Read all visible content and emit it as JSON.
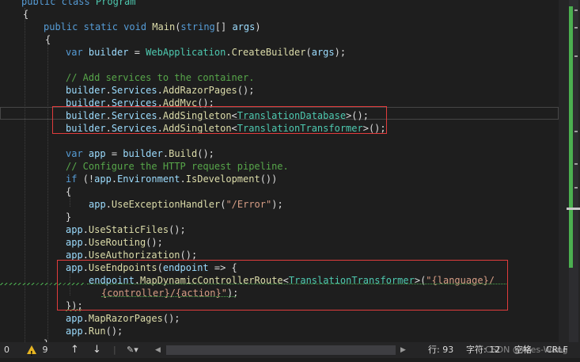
{
  "editor": {
    "lines": [
      {
        "tokens": [
          {
            "c": "kw",
            "t": "public class "
          },
          {
            "c": "ty",
            "t": "Program"
          }
        ]
      },
      {
        "tokens": [
          {
            "c": "pl",
            "t": "{"
          }
        ]
      },
      {
        "tokens": [
          {
            "c": "kw",
            "t": "public static void "
          },
          {
            "c": "fn",
            "t": "Main"
          },
          {
            "c": "pl",
            "t": "("
          },
          {
            "c": "kw",
            "t": "string"
          },
          {
            "c": "pl",
            "t": "[] "
          },
          {
            "c": "vr",
            "t": "args"
          },
          {
            "c": "pl",
            "t": ")"
          }
        ]
      },
      {
        "tokens": [
          {
            "c": "pl",
            "t": "{"
          }
        ]
      },
      {
        "tokens": [
          {
            "c": "kw",
            "t": "var "
          },
          {
            "c": "vr",
            "t": "builder"
          },
          {
            "c": "pl",
            "t": " = "
          },
          {
            "c": "ty",
            "t": "WebApplication"
          },
          {
            "c": "pl",
            "t": "."
          },
          {
            "c": "fn",
            "t": "CreateBuilder"
          },
          {
            "c": "pl",
            "t": "("
          },
          {
            "c": "vr",
            "t": "args"
          },
          {
            "c": "pl",
            "t": ");"
          }
        ]
      },
      {
        "tokens": []
      },
      {
        "tokens": [
          {
            "c": "cm",
            "t": "// Add services to the container."
          }
        ]
      },
      {
        "tokens": [
          {
            "c": "vr",
            "t": "builder"
          },
          {
            "c": "pl",
            "t": "."
          },
          {
            "c": "vr",
            "t": "Services"
          },
          {
            "c": "pl",
            "t": "."
          },
          {
            "c": "fn",
            "t": "AddRazorPages"
          },
          {
            "c": "pl",
            "t": "();"
          }
        ]
      },
      {
        "tokens": [
          {
            "c": "vr",
            "t": "builder"
          },
          {
            "c": "pl",
            "t": "."
          },
          {
            "c": "vr",
            "t": "Services"
          },
          {
            "c": "pl",
            "t": "."
          },
          {
            "c": "fn",
            "t": "AddMvc"
          },
          {
            "c": "pl",
            "t": "();"
          }
        ]
      },
      {
        "tokens": [
          {
            "c": "vr",
            "t": "builder"
          },
          {
            "c": "pl",
            "t": "."
          },
          {
            "c": "vr",
            "t": "Services"
          },
          {
            "c": "pl",
            "t": "."
          },
          {
            "c": "fn",
            "t": "AddSingleton"
          },
          {
            "c": "pl",
            "t": "<"
          },
          {
            "c": "ty",
            "t": "TranslationDatabase"
          },
          {
            "c": "pl",
            "t": ">();"
          }
        ]
      },
      {
        "tokens": [
          {
            "c": "vr",
            "t": "builder"
          },
          {
            "c": "pl",
            "t": "."
          },
          {
            "c": "vr",
            "t": "Services"
          },
          {
            "c": "pl",
            "t": "."
          },
          {
            "c": "fn",
            "t": "AddSingleton"
          },
          {
            "c": "pl",
            "t": "<"
          },
          {
            "c": "ty",
            "t": "TranslationTransformer"
          },
          {
            "c": "pl",
            "t": ">();"
          }
        ]
      },
      {
        "tokens": []
      },
      {
        "tokens": [
          {
            "c": "kw",
            "t": "var "
          },
          {
            "c": "vr",
            "t": "app"
          },
          {
            "c": "pl",
            "t": " = "
          },
          {
            "c": "vr",
            "t": "builder"
          },
          {
            "c": "pl",
            "t": "."
          },
          {
            "c": "fn",
            "t": "Build"
          },
          {
            "c": "pl",
            "t": "();"
          }
        ]
      },
      {
        "tokens": [
          {
            "c": "cm",
            "t": "// Configure the HTTP request pipeline."
          }
        ]
      },
      {
        "tokens": [
          {
            "c": "kw",
            "t": "if "
          },
          {
            "c": "pl",
            "t": "(!"
          },
          {
            "c": "vr",
            "t": "app"
          },
          {
            "c": "pl",
            "t": "."
          },
          {
            "c": "vr",
            "t": "Environment"
          },
          {
            "c": "pl",
            "t": "."
          },
          {
            "c": "fn",
            "t": "IsDevelopment"
          },
          {
            "c": "pl",
            "t": "())"
          }
        ]
      },
      {
        "tokens": [
          {
            "c": "pl",
            "t": "{"
          }
        ]
      },
      {
        "tokens": [
          {
            "c": "vr",
            "t": "app"
          },
          {
            "c": "pl",
            "t": "."
          },
          {
            "c": "fn",
            "t": "UseExceptionHandler"
          },
          {
            "c": "pl",
            "t": "("
          },
          {
            "c": "str",
            "t": "\"/Error\""
          },
          {
            "c": "pl",
            "t": ");"
          }
        ]
      },
      {
        "tokens": [
          {
            "c": "pl",
            "t": "}"
          }
        ]
      },
      {
        "tokens": [
          {
            "c": "vr",
            "t": "app"
          },
          {
            "c": "pl",
            "t": "."
          },
          {
            "c": "fn",
            "t": "UseStaticFiles"
          },
          {
            "c": "pl",
            "t": "();"
          }
        ]
      },
      {
        "tokens": [
          {
            "c": "vr",
            "t": "app"
          },
          {
            "c": "pl",
            "t": "."
          },
          {
            "c": "fn",
            "t": "UseRouting"
          },
          {
            "c": "pl",
            "t": "();"
          }
        ]
      },
      {
        "tokens": [
          {
            "c": "vr",
            "t": "app"
          },
          {
            "c": "pl",
            "t": "."
          },
          {
            "c": "fn",
            "t": "UseAuthorization"
          },
          {
            "c": "pl",
            "t": "();"
          }
        ]
      },
      {
        "tokens": [
          {
            "c": "vr",
            "t": "app"
          },
          {
            "c": "pl",
            "t": "."
          },
          {
            "c": "fn",
            "t": "UseEndpoints"
          },
          {
            "c": "pl",
            "t": "("
          },
          {
            "c": "vr",
            "t": "endpoint"
          },
          {
            "c": "pl",
            "t": " => {"
          }
        ]
      },
      {
        "tokens": [
          {
            "c": "vr",
            "t": "endpoint"
          },
          {
            "c": "pl",
            "t": "."
          },
          {
            "c": "fn",
            "t": "MapDynamicControllerRoute"
          },
          {
            "c": "pl",
            "t": "<"
          },
          {
            "c": "ty",
            "t": "TranslationTransformer"
          },
          {
            "c": "pl",
            "t": ">("
          },
          {
            "c": "str",
            "t": "\"{language}/"
          }
        ]
      },
      {
        "tokens": [
          {
            "c": "str",
            "t": "{controller}/{action}\""
          },
          {
            "c": "pl",
            "t": ");"
          }
        ]
      },
      {
        "tokens": [
          {
            "c": "pl",
            "t": "});"
          }
        ]
      },
      {
        "tokens": [
          {
            "c": "vr",
            "t": "app"
          },
          {
            "c": "pl",
            "t": "."
          },
          {
            "c": "fn",
            "t": "MapRazorPages"
          },
          {
            "c": "pl",
            "t": "();"
          }
        ]
      },
      {
        "tokens": [
          {
            "c": "vr",
            "t": "app"
          },
          {
            "c": "pl",
            "t": "."
          },
          {
            "c": "fn",
            "t": "Run"
          },
          {
            "c": "pl",
            "t": "();"
          }
        ]
      },
      {
        "tokens": [
          {
            "c": "pl",
            "t": "}"
          }
        ]
      }
    ]
  },
  "statusbar": {
    "zoom": "0",
    "warnings": "9",
    "line": "行: 93",
    "char": "字符: 12",
    "spaces": "空格",
    "crlf": "CRLF",
    "watermark": "CSDN @Ares-Wang"
  },
  "colors": {
    "background": "#1e1e1e",
    "highlight_box": "#e03c3c",
    "warning_squiggle": "#4caf50"
  }
}
